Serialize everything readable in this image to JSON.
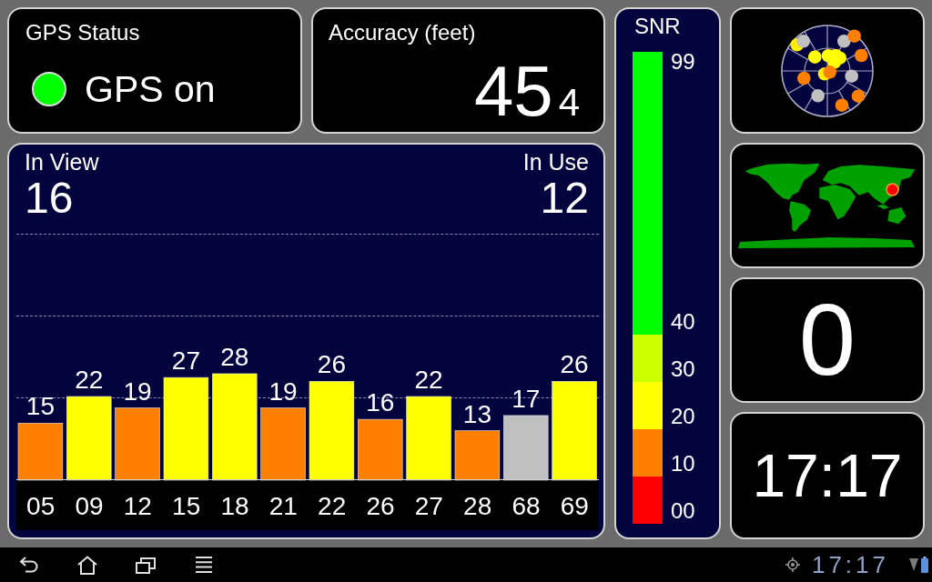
{
  "gps_status": {
    "title": "GPS Status",
    "on": true,
    "label": "GPS on"
  },
  "accuracy": {
    "title": "Accuracy (feet)",
    "value": "45",
    "fraction": "4"
  },
  "satellites": {
    "in_view": {
      "label": "In View",
      "value": "16"
    },
    "in_use": {
      "label": "In Use",
      "value": "12"
    },
    "chart_data": {
      "type": "bar",
      "categories": [
        "05",
        "09",
        "12",
        "15",
        "18",
        "21",
        "22",
        "26",
        "27",
        "28",
        "68",
        "69"
      ],
      "values": [
        15,
        22,
        19,
        27,
        28,
        19,
        26,
        16,
        22,
        13,
        17,
        26
      ],
      "data_labels": true,
      "colors": [
        "#ff8000",
        "#ffff00",
        "#ff8000",
        "#ffff00",
        "#ffff00",
        "#ff8000",
        "#ffff00",
        "#ff8000",
        "#ffff00",
        "#ff8000",
        "#c0c0c0",
        "#ffff00"
      ]
    }
  },
  "snr": {
    "title": "SNR",
    "top_label": "99",
    "bands": [
      {
        "label": "40",
        "color": "#00ff00"
      },
      {
        "label": "30",
        "color": "#ccff00"
      },
      {
        "label": "20",
        "color": "#ffff00"
      },
      {
        "label": "10",
        "color": "#ff8000"
      },
      {
        "label": "00",
        "color": "#ff0000"
      }
    ]
  },
  "number_tile": {
    "value": "0"
  },
  "clock_tile": {
    "time": "17:17"
  },
  "status_bar": {
    "time": "17:17"
  }
}
